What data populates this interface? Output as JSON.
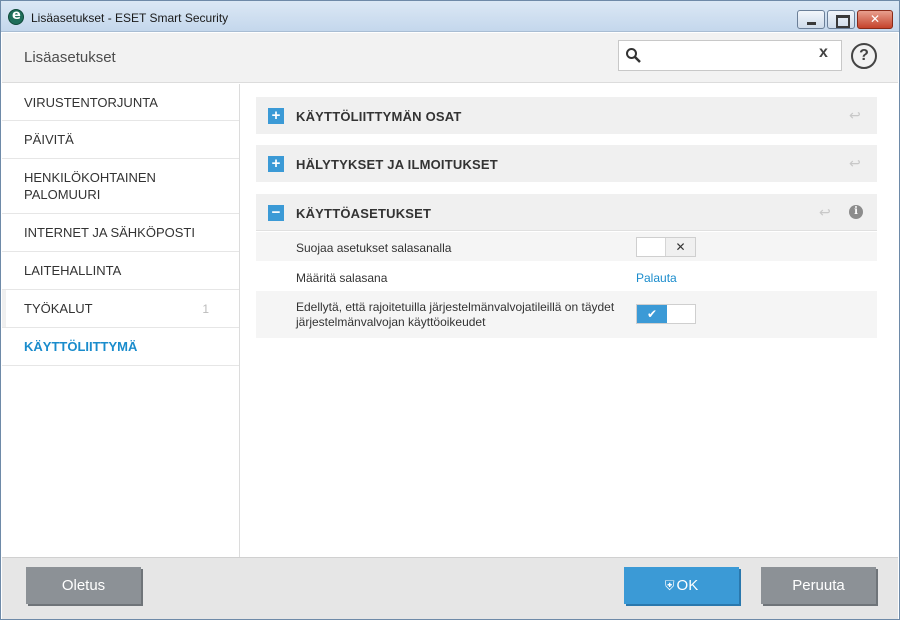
{
  "window": {
    "title": "Lisäasetukset - ESET Smart Security"
  },
  "header": {
    "title": "Lisäasetukset",
    "search_placeholder": "",
    "search_clear": "x",
    "help": "?"
  },
  "sidebar": {
    "items": [
      {
        "label": "VIRUSTENTORJUNTA",
        "count": ""
      },
      {
        "label": "PÄIVITÄ",
        "count": ""
      },
      {
        "label": "HENKILÖKOHTAINEN PALOMUURI",
        "count": ""
      },
      {
        "label": "INTERNET JA SÄHKÖPOSTI",
        "count": ""
      },
      {
        "label": "LAITEHALLINTA",
        "count": ""
      },
      {
        "label": "TYÖKALUT",
        "count": "1"
      },
      {
        "label": "KÄYTTÖLIITTYMÄ",
        "count": ""
      }
    ],
    "active_index": 6
  },
  "main": {
    "sections": [
      {
        "title": "KÄYTTÖLIITTYMÄN OSAT",
        "toggle": "+",
        "expanded": false
      },
      {
        "title": "HÄLYTYKSET JA ILMOITUKSET",
        "toggle": "+",
        "expanded": false
      },
      {
        "title": "KÄYTTÖASETUKSET",
        "toggle": "−",
        "expanded": true
      }
    ],
    "settings": [
      {
        "label": "Suojaa asetukset salasanalla",
        "control": "toggle",
        "state": "off",
        "knob": "✕"
      },
      {
        "label": "Määritä salasana",
        "control": "link",
        "link_text": "Palauta"
      },
      {
        "label": "Edellytä, että rajoitetuilla järjestelmänvalvojatileillä on täydet järjestelmänvalvojan käyttöoikeudet",
        "control": "toggle",
        "state": "on",
        "knob": "✔"
      }
    ]
  },
  "footer": {
    "default_label": "Oletus",
    "ok_label": "OK",
    "cancel_label": "Peruuta"
  },
  "colors": {
    "accent": "#3b9ad6",
    "active_nav": "#1a8ccc",
    "button_gray": "#8c9196"
  },
  "icons": {
    "app": "eset-logo-icon",
    "search": "search-icon",
    "help": "help-icon",
    "revert": "revert-icon",
    "info": "info-icon",
    "ok_shield": "shield-icon"
  }
}
